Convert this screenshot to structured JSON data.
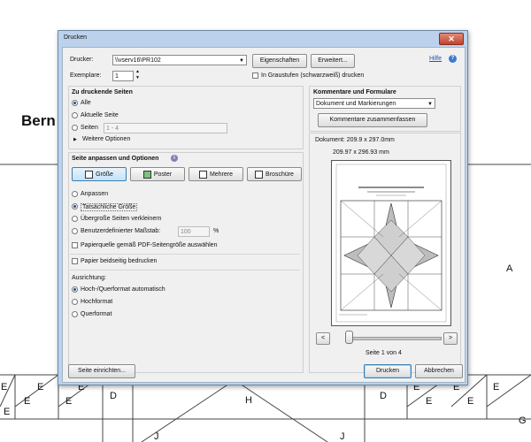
{
  "background": {
    "title": "Bern",
    "letters_right": [
      "A"
    ],
    "bottom_row": [
      "E",
      "E",
      "E",
      "E",
      "E",
      "E",
      "D",
      "H",
      "D",
      "E",
      "E",
      "E",
      "E",
      "E",
      "G"
    ],
    "bottom_J": [
      "J",
      "J"
    ]
  },
  "dialog": {
    "title": "Drucken",
    "close_glyph": "✕",
    "printer_label": "Drucker:",
    "printer_value": "\\\\vserv16\\PR102",
    "properties_btn": "Eigenschaften",
    "advanced_btn": "Erweitert...",
    "help_link": "Hilfe",
    "copies_label": "Exemplare:",
    "copies_value": "1",
    "grayscale_label": "In Graustufen (schwarzweiß) drucken",
    "pages_section": {
      "title": "Zu druckende Seiten",
      "all": "Alle",
      "current": "Aktuelle Seite",
      "pages": "Seiten",
      "pages_value": "1 - 4",
      "more_options": "Weitere Optionen"
    },
    "sizing_section": {
      "title": "Seite anpassen und Optionen",
      "tabs": [
        "Größe",
        "Poster",
        "Mehrere",
        "Broschüre"
      ],
      "fit": "Anpassen",
      "actual": "Tatsächliche Größe",
      "shrink": "Übergroße Seiten verkleinern",
      "custom": "Benutzerdefinierter Maßstab:",
      "custom_value": "100",
      "percent": "%",
      "paper_source": "Papierquelle gemäß PDF-Seitengröße auswählen",
      "duplex": "Papier beidseitig bedrucken",
      "orientation_title": "Ausrichtung:",
      "auto": "Hoch-/Querformat automatisch",
      "portrait": "Hochformat",
      "landscape": "Querformat"
    },
    "comments_section": {
      "title": "Kommentare und Formulare",
      "select_value": "Dokument und Markierungen",
      "summarize_btn": "Kommentare zusammenfassen"
    },
    "preview": {
      "document_size": "Dokument: 209.9 x 297.0mm",
      "paper_size": "209.97 x 296.93 mm",
      "prev": "<",
      "next": ">",
      "page_info": "Seite 1 von 4"
    },
    "page_setup_btn": "Seite einrichten...",
    "print_btn": "Drucken",
    "cancel_btn": "Abbrechen"
  }
}
